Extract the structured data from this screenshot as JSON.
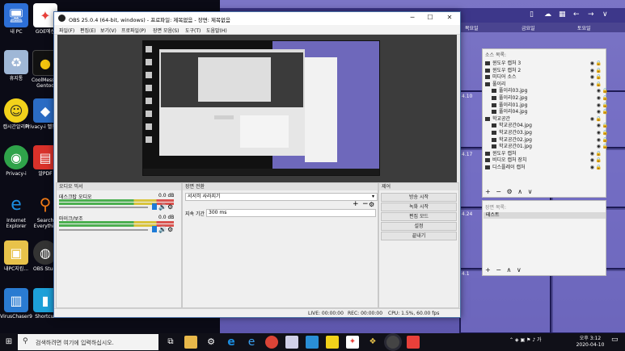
{
  "desktop": {
    "icons": [
      {
        "label": "내 PC",
        "icon": "computer-icon",
        "color": "#2d6fd6"
      },
      {
        "label": "GOE에신",
        "icon": "goe-app-icon",
        "color": "#e8403a"
      },
      {
        "label": "휴지통",
        "icon": "recycle-bin-icon",
        "color": "#9fb7d6"
      },
      {
        "label": "CoolMess... Gentoo",
        "icon": "coolmessenger-icon",
        "color": "#111111"
      },
      {
        "label": "캡시간알리미",
        "icon": "smiley-icon",
        "color": "#f2d21b"
      },
      {
        "label": "Privacy-i 벨프테스",
        "icon": "privacy-i-cube-icon",
        "color": "#2b6cc4"
      },
      {
        "label": "Privacy-i",
        "icon": "privacy-i-icon",
        "color": "#2fa34a"
      },
      {
        "label": "알PDF",
        "icon": "alpdf-icon",
        "color": "#d9312a"
      },
      {
        "label": "Internet Explorer",
        "icon": "internet-explorer-icon",
        "color": "#1b8de0"
      },
      {
        "label": "Search Everythin",
        "icon": "search-everything-icon",
        "color": "#f27b16"
      },
      {
        "label": "내PC지킴...",
        "icon": "mypc-keeper-icon",
        "color": "#e8c24a"
      },
      {
        "label": "OBS Studi",
        "icon": "obs-studio-icon",
        "color": "#333333"
      },
      {
        "label": "VirusChaser9",
        "icon": "viruschaser-icon",
        "color": "#2a7bd1"
      },
      {
        "label": "Shortcut",
        "icon": "shortcut-icon",
        "color": "#1da0d8"
      }
    ],
    "calendar": {
      "toolbar_icons": [
        "phone-icon",
        "cloud-icon",
        "calendar-icon",
        "back-arrow-icon",
        "forward-arrow-icon",
        "chevron-down-icon"
      ],
      "day_headers": [
        "목요일",
        "금요일",
        "토요일"
      ],
      "cell_numbers": [
        "4.10",
        "4.17",
        "4.24",
        "4.1"
      ]
    }
  },
  "obs": {
    "title": "OBS 25.0.4 (64-bit, windows) - 프로파일: 제목없음 - 장면: 제목없음",
    "menu": [
      "파일(F)",
      "편집(E)",
      "보기(V)",
      "프로파일(P)",
      "장면 모음(S)",
      "도구(T)",
      "도움말(H)"
    ],
    "audio_mixer": {
      "title": "오디오 믹서",
      "channels": [
        {
          "name": "데스크탑 오디오",
          "db": "0.0 dB"
        },
        {
          "name": "마이크/보조",
          "db": "0.0 dB"
        }
      ]
    },
    "transition": {
      "title": "장면 전환",
      "selected": "서서히 사라지기",
      "duration_label": "지속 기간",
      "duration_value": "300 ms"
    },
    "controls": {
      "title": "제어",
      "buttons": [
        "방송 시작",
        "녹화 시작",
        "편집 모드",
        "설정",
        "끝내기"
      ]
    },
    "status": {
      "live": "LIVE: 00:00:00",
      "rec": "REC: 00:00:00",
      "cpu": "CPU: 1.5%, 60.00 fps"
    }
  },
  "sources": {
    "header": "소스 목록:",
    "items": [
      {
        "label": "윈도우 캡처 3",
        "indent": 0
      },
      {
        "label": "윈도우 캡처 2",
        "indent": 0
      },
      {
        "label": "미디어 소스",
        "indent": 0
      },
      {
        "label": "풀이리",
        "indent": 0
      },
      {
        "label": "풀이리03.jpg",
        "indent": 1
      },
      {
        "label": "풀이리02.jpg",
        "indent": 1
      },
      {
        "label": "풀이리01.jpg",
        "indent": 1
      },
      {
        "label": "풀이리04.jpg",
        "indent": 1
      },
      {
        "label": "학교공간",
        "indent": 0
      },
      {
        "label": "학교공간04.jpg",
        "indent": 1
      },
      {
        "label": "학교공간03.jpg",
        "indent": 1
      },
      {
        "label": "학교공간02.jpg",
        "indent": 1
      },
      {
        "label": "학교공간01.jpg",
        "indent": 1
      },
      {
        "label": "윈도우 캡처",
        "indent": 0
      },
      {
        "label": "비디오 캡처 장치",
        "indent": 0
      },
      {
        "label": "디스플레이 캡처",
        "indent": 0
      }
    ],
    "controls": "+ − ⚙ ∧ ∨"
  },
  "scenes": {
    "header": "장면 목록:",
    "selected": "테스트",
    "controls": "+ − ∧ ∨"
  },
  "taskbar": {
    "search_placeholder": "검색하려면 여기에 입력하십시오.",
    "apps": [
      "task-view-icon",
      "file-explorer-icon",
      "settings-icon",
      "edge-icon",
      "ie-icon",
      "chrome-icon",
      "paint-icon",
      "app-icon",
      "sticky-notes-icon",
      "goe-icon",
      "app2-icon",
      "obs-icon",
      "app3-icon"
    ],
    "time": "오후 3:12",
    "date": "2020-04-10"
  }
}
